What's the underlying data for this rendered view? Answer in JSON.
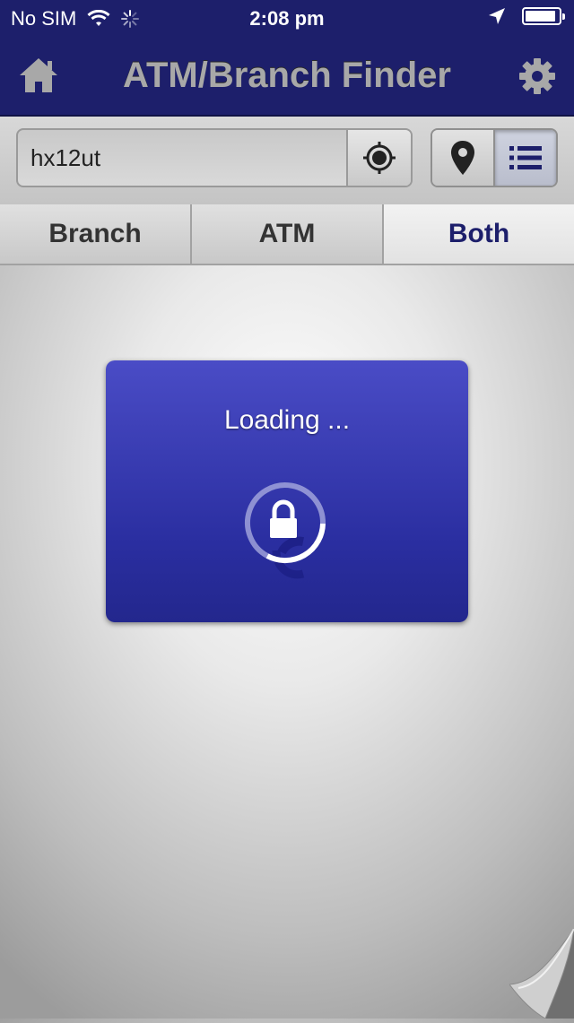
{
  "status_bar": {
    "carrier": "No SIM",
    "time": "2:08 pm",
    "battery_level": 0.92
  },
  "nav": {
    "title": "ATM/Branch Finder",
    "left_icon": "home-icon",
    "right_icon": "gear-icon"
  },
  "search": {
    "value": "hx12ut",
    "locate_icon": "crosshair-icon"
  },
  "view_toggle": {
    "map_icon": "map-pin-icon",
    "list_icon": "list-icon",
    "selected": "list"
  },
  "segments": {
    "items": [
      {
        "label": "Branch"
      },
      {
        "label": "ATM"
      },
      {
        "label": "Both"
      }
    ],
    "selected": "Both"
  },
  "loading": {
    "text": "Loading ...",
    "icon": "lock-spinner-icon"
  },
  "colors": {
    "navy": "#1d1f6b",
    "dialog_blue": "#3a3cb6",
    "title_gray": "#a8a8a8"
  }
}
